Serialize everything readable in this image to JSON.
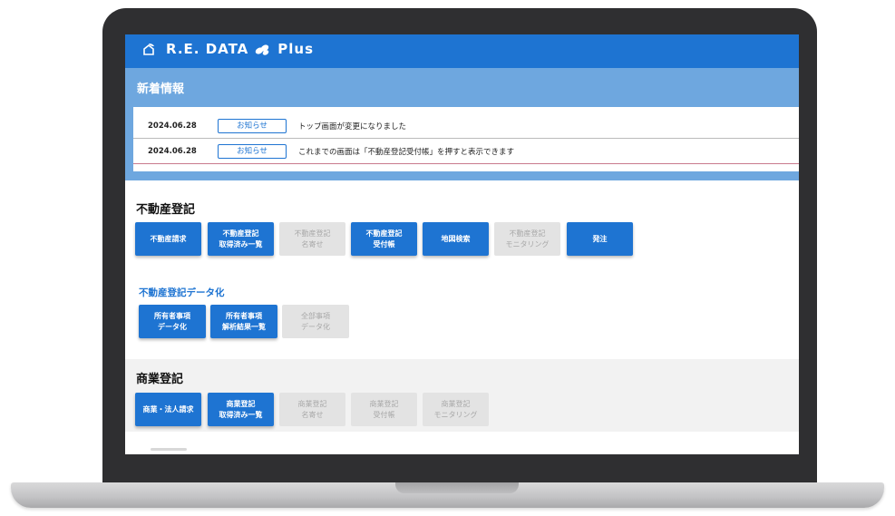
{
  "app": {
    "brand_left": "R.E. DATA",
    "brand_right": "Plus",
    "logo_icon": "house-leaf-icon",
    "plus_icon": "leaf-cluster-icon"
  },
  "news": {
    "title": "新着情報",
    "items": [
      {
        "date": "2024.06.28",
        "badge": "お知らせ",
        "text": "トップ画面が変更になりました"
      },
      {
        "date": "2024.06.28",
        "badge": "お知らせ",
        "text": "これまでの画面は「不動産登記受付帳」を押すと表示できます"
      }
    ]
  },
  "real_estate": {
    "title": "不動産登記",
    "buttons": [
      {
        "lines": [
          "不動産請求"
        ],
        "enabled": true
      },
      {
        "lines": [
          "不動産登記",
          "取得済み一覧"
        ],
        "enabled": true
      },
      {
        "lines": [
          "不動産登記",
          "名寄せ"
        ],
        "enabled": false
      },
      {
        "lines": [
          "不動産登記",
          "受付帳"
        ],
        "enabled": true
      },
      {
        "lines": [
          "地図検索"
        ],
        "enabled": true
      },
      {
        "lines": [
          "不動産登記",
          "モニタリング"
        ],
        "enabled": false
      },
      {
        "lines": [
          "発注"
        ],
        "enabled": true
      }
    ],
    "digitize": {
      "title": "不動産登記データ化",
      "buttons": [
        {
          "lines": [
            "所有者事項",
            "データ化"
          ],
          "enabled": true
        },
        {
          "lines": [
            "所有者事項",
            "解析結果一覧"
          ],
          "enabled": true
        },
        {
          "lines": [
            "全部事項",
            "データ化"
          ],
          "enabled": false
        }
      ]
    }
  },
  "commercial": {
    "title": "商業登記",
    "buttons": [
      {
        "lines": [
          "商業・法人請求"
        ],
        "enabled": true
      },
      {
        "lines": [
          "商業登記",
          "取得済み一覧"
        ],
        "enabled": true
      },
      {
        "lines": [
          "商業登記",
          "名寄せ"
        ],
        "enabled": false
      },
      {
        "lines": [
          "商業登記",
          "受付帳"
        ],
        "enabled": false
      },
      {
        "lines": [
          "商業登記",
          "モニタリング"
        ],
        "enabled": false
      }
    ]
  },
  "colors": {
    "primary": "#1e74d2",
    "panel": "#6ea7df",
    "disabled_bg": "#e3e3e3",
    "disabled_text": "#a8a8a8"
  }
}
